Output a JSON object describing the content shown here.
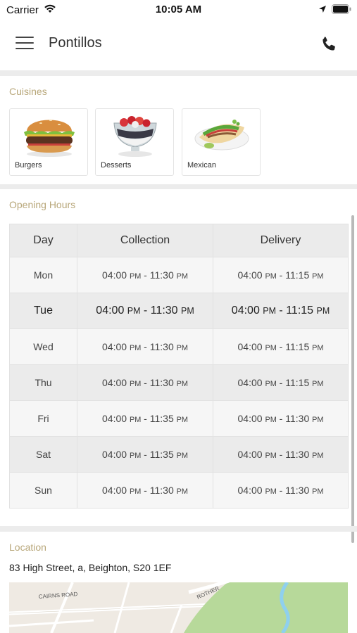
{
  "status_bar": {
    "carrier": "Carrier",
    "time": "10:05 AM"
  },
  "header": {
    "title": "Pontillos",
    "menu_icon": "hamburger-menu-icon",
    "phone_icon": "phone-icon"
  },
  "cuisines": {
    "title": "Cuisines",
    "items": [
      {
        "label": "Burgers",
        "icon": "burger-image"
      },
      {
        "label": "Desserts",
        "icon": "dessert-image"
      },
      {
        "label": "Mexican",
        "icon": "mexican-image"
      }
    ]
  },
  "opening_hours": {
    "title": "Opening Hours",
    "headers": [
      "Day",
      "Collection",
      "Delivery"
    ],
    "rows": [
      {
        "day": "Mon",
        "collection": "04:00 PM - 11:30 PM",
        "delivery": "04:00 PM - 11:15 PM"
      },
      {
        "day": "Tue",
        "collection": "04:00 PM - 11:30 PM",
        "delivery": "04:00 PM - 11:15 PM"
      },
      {
        "day": "Wed",
        "collection": "04:00 PM - 11:30 PM",
        "delivery": "04:00 PM - 11:15 PM"
      },
      {
        "day": "Thu",
        "collection": "04:00 PM - 11:30 PM",
        "delivery": "04:00 PM - 11:15 PM"
      },
      {
        "day": "Fri",
        "collection": "04:00 PM - 11:35 PM",
        "delivery": "04:00 PM - 11:30 PM"
      },
      {
        "day": "Sat",
        "collection": "04:00 PM - 11:35 PM",
        "delivery": "04:00 PM - 11:30 PM"
      },
      {
        "day": "Sun",
        "collection": "04:00 PM - 11:30 PM",
        "delivery": "04:00 PM - 11:30 PM"
      }
    ],
    "highlighted_day": "Tue"
  },
  "location": {
    "title": "Location",
    "address": "83 High Street, a, Beighton, S20 1EF",
    "map_labels": {
      "road_1": "CAIRNS ROAD",
      "road_2": "ROTHER"
    }
  },
  "colors": {
    "section_title": "#b8a77a",
    "divider": "#ececec",
    "table_header_bg": "#ebebeb",
    "map_green": "#b7d99a",
    "map_water": "#8fd0ee"
  }
}
